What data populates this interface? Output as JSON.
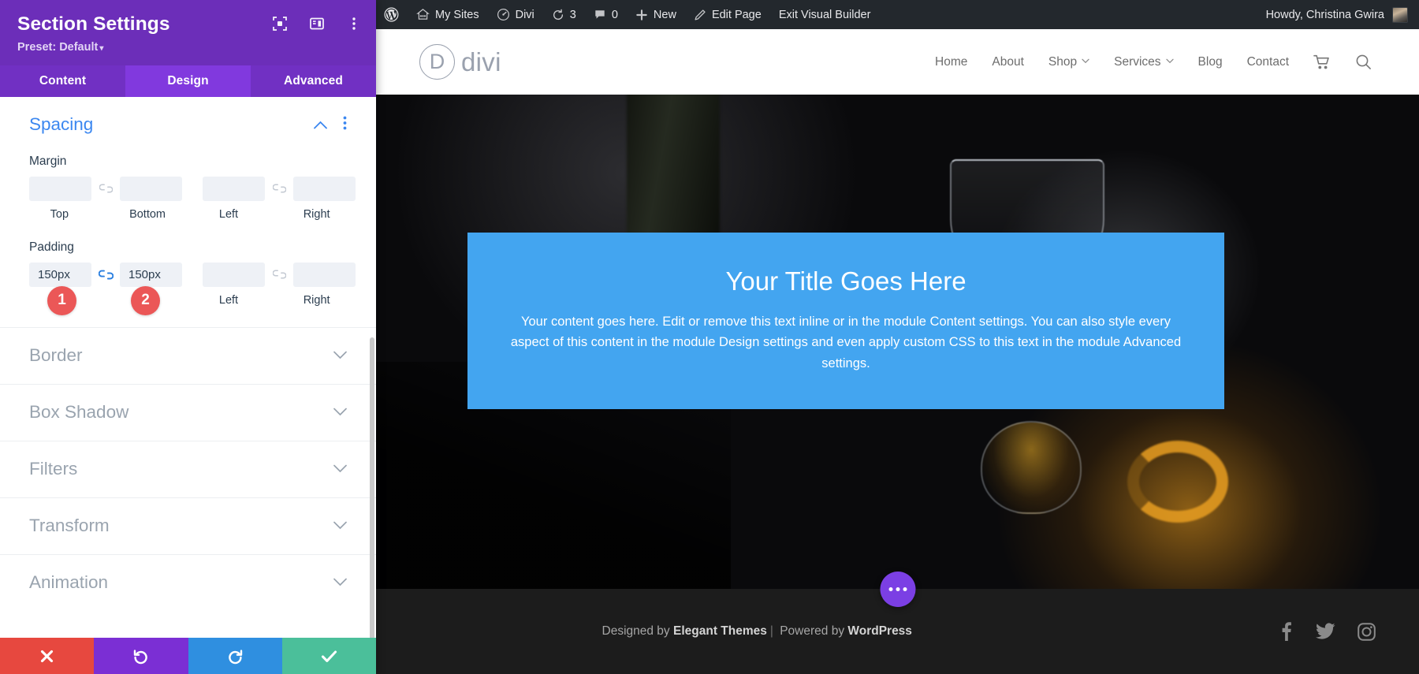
{
  "panel": {
    "title": "Section Settings",
    "preset_label": "Preset: Default",
    "caret": "▾",
    "header_icons": [
      {
        "name": "focus-target-icon"
      },
      {
        "name": "layout-columns-icon"
      },
      {
        "name": "more-vertical-icon"
      }
    ],
    "tabs": [
      {
        "label": "Content",
        "active": false
      },
      {
        "label": "Design",
        "active": true
      },
      {
        "label": "Advanced",
        "active": false
      }
    ],
    "spacing": {
      "title": "Spacing",
      "collapse_icon": "˄",
      "more_icon": "⋮",
      "margin": {
        "label": "Margin",
        "top_value": "",
        "bottom_value": "",
        "left_value": "",
        "right_value": "",
        "captions": [
          "Top",
          "Bottom",
          "Left",
          "Right"
        ],
        "link_left_active": false,
        "link_right_active": false
      },
      "padding": {
        "label": "Padding",
        "top_value": "150px",
        "bottom_value": "150px",
        "left_value": "",
        "right_value": "",
        "captions": [
          "Top",
          "Bottom",
          "Left",
          "Right"
        ],
        "link_left_active": true,
        "link_right_active": false
      }
    },
    "annotations": [
      {
        "number": "1",
        "color": "#eb5757"
      },
      {
        "number": "2",
        "color": "#eb5757"
      }
    ],
    "accordion": [
      {
        "label": "Border",
        "chevron": "⌄"
      },
      {
        "label": "Box Shadow",
        "chevron": "⌄"
      },
      {
        "label": "Filters",
        "chevron": "⌄"
      },
      {
        "label": "Transform",
        "chevron": "⌄"
      },
      {
        "label": "Animation",
        "chevron": "⌄"
      }
    ],
    "footer_buttons": [
      {
        "name": "cancel-button",
        "icon": "close-icon",
        "color": "#e7483f"
      },
      {
        "name": "undo-button",
        "icon": "undo-icon",
        "color": "#7b2fd4"
      },
      {
        "name": "redo-button",
        "icon": "redo-icon",
        "color": "#2f8fe0"
      },
      {
        "name": "save-button",
        "icon": "checkmark-icon",
        "color": "#4bbf9a"
      }
    ]
  },
  "admin_bar": {
    "items": [
      {
        "name": "wordpress-logo-icon",
        "label": ""
      },
      {
        "name": "my-sites",
        "label": "My Sites"
      },
      {
        "name": "site-divi",
        "label": "Divi"
      },
      {
        "name": "updates",
        "label": "3"
      },
      {
        "name": "comments",
        "label": "0"
      },
      {
        "name": "new",
        "label": "New"
      },
      {
        "name": "edit-page",
        "label": "Edit Page"
      },
      {
        "name": "exit-visual-builder",
        "label": "Exit Visual Builder"
      }
    ],
    "howdy": "Howdy, Christina Gwira"
  },
  "site": {
    "logo": {
      "mark": "D",
      "word": "divi"
    },
    "nav": [
      {
        "label": "Home",
        "has_caret": false
      },
      {
        "label": "About",
        "has_caret": false
      },
      {
        "label": "Shop",
        "has_caret": true
      },
      {
        "label": "Services",
        "has_caret": true
      },
      {
        "label": "Blog",
        "has_caret": false
      },
      {
        "label": "Contact",
        "has_caret": false
      }
    ],
    "nav_icons": [
      {
        "name": "cart-icon"
      },
      {
        "name": "search-icon"
      }
    ],
    "promo": {
      "title": "Your Title Goes Here",
      "body": "Your content goes here. Edit or remove this text inline or in the module Content settings. You can also style every aspect of this content in the module Design settings and even apply custom CSS to this text in the module Advanced settings.",
      "background_color": "#43a5f0"
    },
    "footer": {
      "credit_prefix": "Designed by ",
      "credit_brand": "Elegant Themes",
      "credit_sep": "|",
      "credit_middle": " Powered by ",
      "credit_brand2": "WordPress",
      "socials": [
        {
          "name": "facebook-icon"
        },
        {
          "name": "twitter-icon"
        },
        {
          "name": "instagram-icon"
        }
      ]
    },
    "fab": {
      "name": "divi-builder-menu-fab",
      "color": "#7b3fe4"
    }
  }
}
